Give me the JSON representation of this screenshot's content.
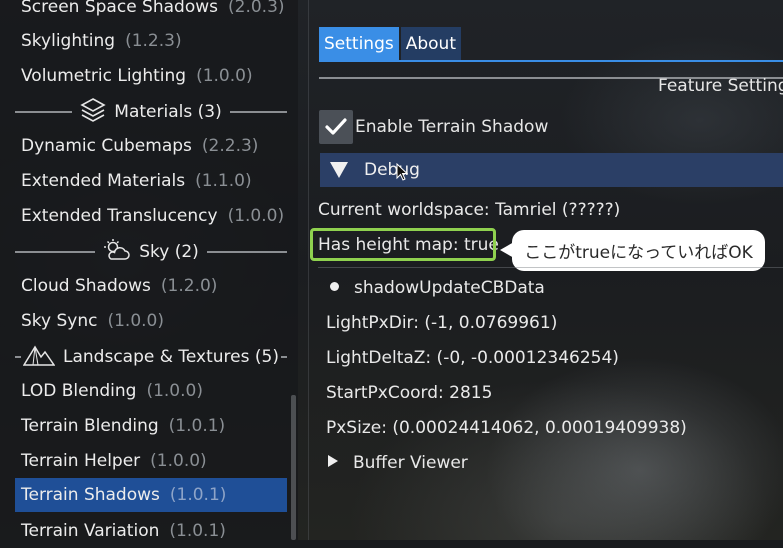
{
  "sidebar": {
    "items": [
      {
        "label": "Screen Space Shadows",
        "version": "(2.0.3)"
      },
      {
        "label": "Skylighting",
        "version": "(1.2.3)"
      },
      {
        "label": "Volumetric Lighting",
        "version": "(1.0.0)"
      },
      {
        "label": "Dynamic Cubemaps",
        "version": "(2.2.3)"
      },
      {
        "label": "Extended Materials",
        "version": "(1.1.0)"
      },
      {
        "label": "Extended Translucency",
        "version": "(1.0.0)"
      },
      {
        "label": "Cloud Shadows",
        "version": "(1.2.0)"
      },
      {
        "label": "Sky Sync",
        "version": "(1.0.0)"
      },
      {
        "label": "LOD Blending",
        "version": "(1.0.0)"
      },
      {
        "label": "Terrain Blending",
        "version": "(1.0.1)"
      },
      {
        "label": "Terrain Helper",
        "version": "(1.0.0)"
      },
      {
        "label": "Terrain Shadows",
        "version": "(1.0.1)"
      },
      {
        "label": "Terrain Variation",
        "version": "(1.0.1)"
      }
    ],
    "categories": [
      {
        "label": "Materials (3)",
        "icon": "materials-layers-icon"
      },
      {
        "label": "Sky (2)",
        "icon": "sun-cloud-icon"
      },
      {
        "label": "Landscape & Textures (5)",
        "icon": "mountain-icon"
      }
    ],
    "selected_index": 11
  },
  "tabs": [
    {
      "label": "Settings",
      "active": true
    },
    {
      "label": "About",
      "active": false
    }
  ],
  "feature_settings_title": "Feature Settings",
  "enable_terrain_shadow": {
    "label": "Enable Terrain Shadow",
    "checked": true
  },
  "debug": {
    "header_label": "Debug",
    "current_worldspace": "Current worldspace: Tamriel (?????)",
    "has_height_map": "Has height map: true",
    "callout": "ここがtrueになっていればOK",
    "shadow_update_node": "shadowUpdateCBData",
    "light_px_dir": "LightPxDir: (-1, 0.0769961)",
    "light_delta_z": "LightDeltaZ: (-0, -0.00012346254)",
    "start_px_coord": "StartPxCoord: 2815",
    "px_size": "PxSize: (0.00024414062, 0.00019409938)",
    "buffer_viewer": "Buffer Viewer"
  },
  "colors": {
    "accent": "#3a8ee6",
    "selected": "#1f4f97",
    "highlight_box": "#8fd14f"
  }
}
